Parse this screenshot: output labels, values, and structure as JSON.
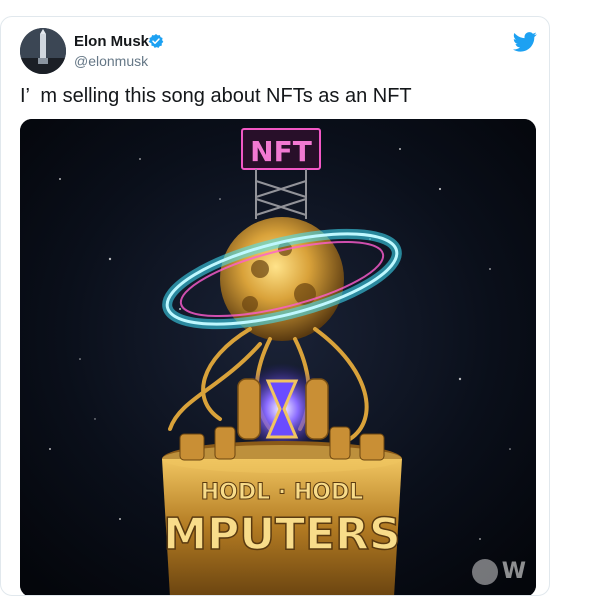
{
  "tweet": {
    "author_name": "Elon Musk",
    "handle": "@elonmusk",
    "text": "I’  m selling this song about NFTs as an NFT",
    "verified_icon": "verified-badge-icon",
    "bird_icon": "twitter-bird-icon"
  },
  "media": {
    "sign_text": "NFT",
    "ring_text_top": "HODL · HODL",
    "ring_text_bottom": "MPUTERS",
    "watermark_text": "W"
  },
  "colors": {
    "twitter_blue": "#1da1f2",
    "text_primary": "#14171a",
    "text_secondary": "#657786",
    "neon_pink": "#ff5ccf",
    "neon_cyan": "#3ee6ff",
    "gold": "#d9a23a"
  }
}
